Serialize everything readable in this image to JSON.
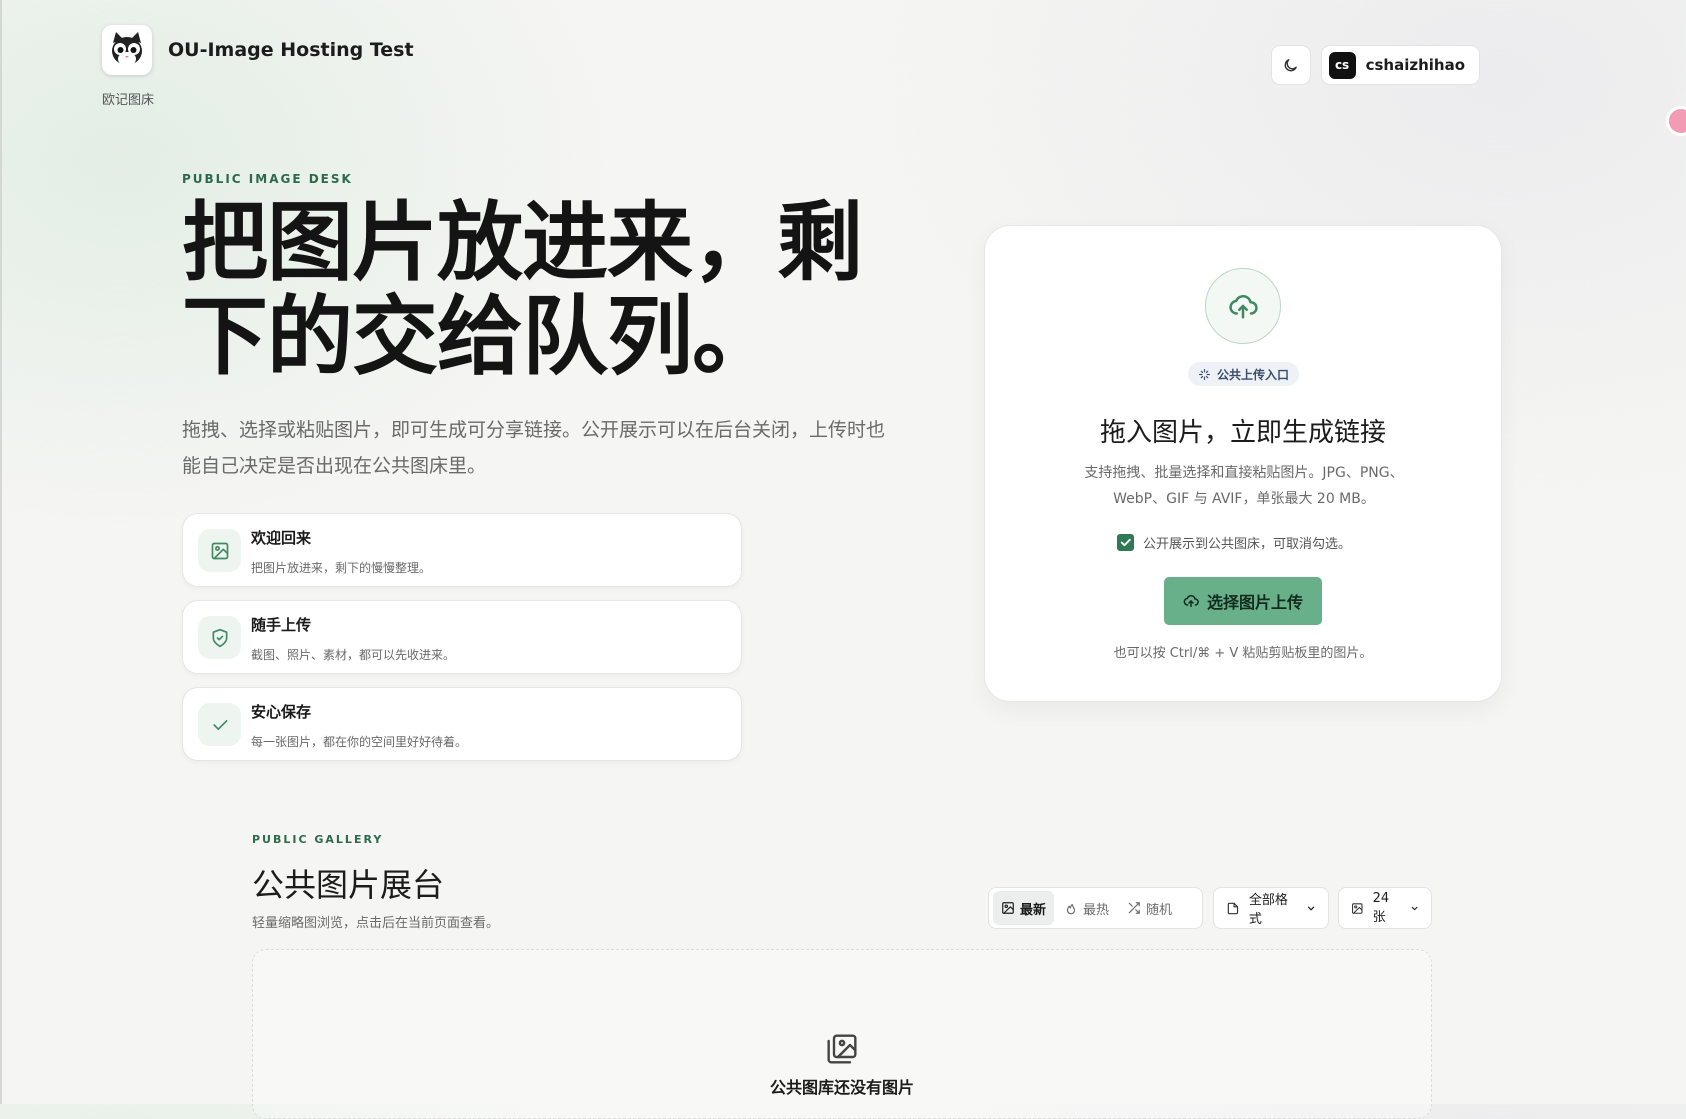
{
  "header": {
    "title": "OU-Image Hosting Test",
    "subtitle": "欧记图床",
    "user_initials": "cs",
    "username": "cshaizhihao"
  },
  "hero": {
    "eyebrow": "PUBLIC IMAGE DESK",
    "title": "把图片放进来，剩下的交给队列。",
    "description": "拖拽、选择或粘贴图片，即可生成可分享链接。公开展示可以在后台关闭，上传时也能自己决定是否出现在公共图床里。",
    "features": [
      {
        "title": "欢迎回来",
        "desc": "把图片放进来，剩下的慢慢整理。",
        "icon": "image-icon"
      },
      {
        "title": "随手上传",
        "desc": "截图、照片、素材，都可以先收进来。",
        "icon": "shield-check-icon"
      },
      {
        "title": "安心保存",
        "desc": "每一张图片，都在你的空间里好好待着。",
        "icon": "check-icon"
      }
    ]
  },
  "upload": {
    "badge": "公共上传入口",
    "title": "拖入图片，立即生成链接",
    "desc_line1": "支持拖拽、批量选择和直接粘贴图片。JPG、PNG、",
    "desc_line2": "WebP、GIF 与 AVIF，单张最大 20 MB。",
    "public_label": "公开展示到公共图床，可取消勾选。",
    "public_checked": true,
    "button": "选择图片上传",
    "hint": "也可以按 Ctrl/⌘ + V 粘贴剪贴板里的图片。"
  },
  "gallery": {
    "eyebrow": "PUBLIC GALLERY",
    "title": "公共图片展台",
    "subtitle": "轻量缩略图浏览，点击后在当前页面查看。",
    "sort": {
      "latest": "最新",
      "hot": "最热",
      "random": "随机",
      "active": "latest"
    },
    "format_filter": "全部格式",
    "page_size": "24 张",
    "empty_text": "公共图库还没有图片"
  },
  "colors": {
    "accent": "#2f7a54",
    "button": "#67b089",
    "eyebrow": "#2d6a4b"
  }
}
